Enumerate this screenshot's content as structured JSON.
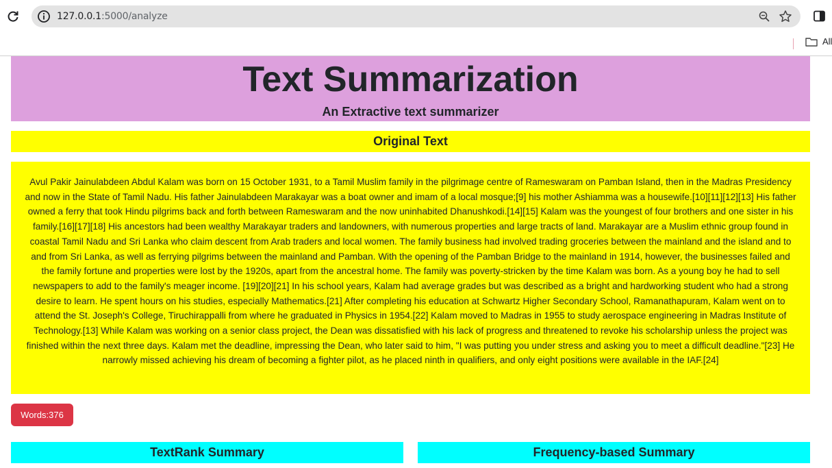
{
  "browser": {
    "url_host": "127.0.0.1",
    "url_path": ":5000/analyze",
    "bookmarks_label": "All"
  },
  "header": {
    "title": "Text Summarization",
    "subtitle": "An Extractive text summarizer"
  },
  "original": {
    "heading": "Original Text",
    "text": "Avul Pakir Jainulabdeen Abdul Kalam was born on 15 October 1931, to a Tamil Muslim family in the pilgrimage centre of Rameswaram on Pamban Island, then in the Madras Presidency and now in the State of Tamil Nadu. His father Jainulabdeen Marakayar was a boat owner and imam of a local mosque;[9] his mother Ashiamma was a housewife.[10][11][12][13] His father owned a ferry that took Hindu pilgrims back and forth between Rameswaram and the now uninhabited Dhanushkodi.[14][15] Kalam was the youngest of four brothers and one sister in his family.[16][17][18] His ancestors had been wealthy Marakayar traders and landowners, with numerous properties and large tracts of land. Marakayar are a Muslim ethnic group found in coastal Tamil Nadu and Sri Lanka who claim descent from Arab traders and local women. The family business had involved trading groceries between the mainland and the island and to and from Sri Lanka, as well as ferrying pilgrims between the mainland and Pamban. With the opening of the Pamban Bridge to the mainland in 1914, however, the businesses failed and the family fortune and properties were lost by the 1920s, apart from the ancestral home. The family was poverty-stricken by the time Kalam was born. As a young boy he had to sell newspapers to add to the family's meager income. [19][20][21] In his school years, Kalam had average grades but was described as a bright and hardworking student who had a strong desire to learn. He spent hours on his studies, especially Mathematics.[21] After completing his education at Schwartz Higher Secondary School, Ramanathapuram, Kalam went on to attend the St. Joseph's College, Tiruchirappalli from where he graduated in Physics in 1954.[22] Kalam moved to Madras in 1955 to study aerospace engineering in Madras Institute of Technology.[13] While Kalam was working on a senior class project, the Dean was dissatisfied with his lack of progress and threatened to revoke his scholarship unless the project was finished within the next three days. Kalam met the deadline, impressing the Dean, who later said to him, \"I was putting you under stress and asking you to meet a difficult deadline.\"[23] He narrowly missed achieving his dream of becoming a fighter pilot, as he placed ninth in qualifiers, and only eight positions were available in the IAF.[24]"
  },
  "word_count_label": "Words:376",
  "summaries": {
    "textrank_heading": "TextRank Summary",
    "frequency_heading": "Frequency-based Summary"
  },
  "colors": {
    "header_bg": "#dda0dd",
    "original_bg": "#ffff00",
    "badge_bg": "#dc3545",
    "summary_heading_bg": "#00ffff"
  }
}
